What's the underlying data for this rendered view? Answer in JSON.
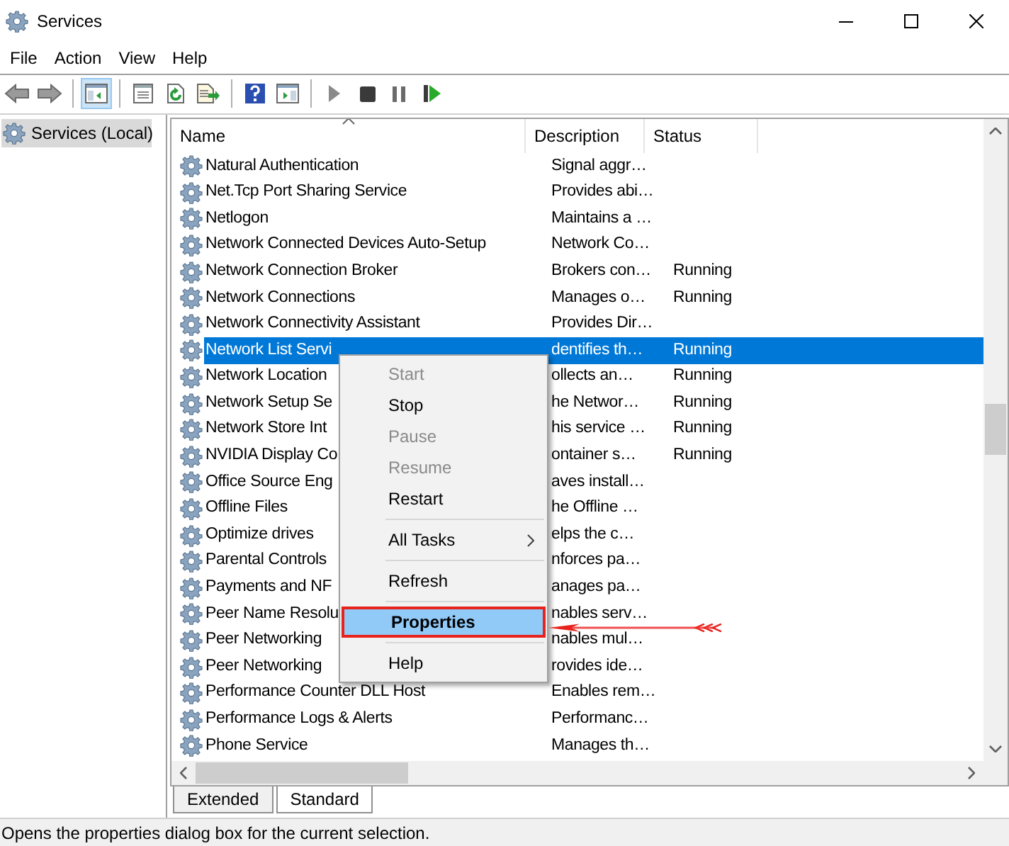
{
  "window": {
    "title": "Services"
  },
  "menu_bar": [
    "File",
    "Action",
    "View",
    "Help"
  ],
  "toolbar": [
    [
      {
        "kind": "back",
        "pressed": false
      },
      {
        "kind": "forward",
        "pressed": false
      }
    ],
    [
      {
        "kind": "tree",
        "pressed": true
      }
    ],
    [
      {
        "kind": "props",
        "pressed": false
      },
      {
        "kind": "refresh",
        "pressed": false
      },
      {
        "kind": "export",
        "pressed": false
      }
    ],
    [
      {
        "kind": "help",
        "pressed": false
      },
      {
        "kind": "pane",
        "pressed": false
      }
    ],
    [
      {
        "kind": "play",
        "pressed": false
      },
      {
        "kind": "stop",
        "pressed": false
      },
      {
        "kind": "pause",
        "pressed": false
      },
      {
        "kind": "restart",
        "pressed": false
      }
    ]
  ],
  "tree": {
    "items": [
      {
        "label": "Services (Local)",
        "selected": true
      }
    ]
  },
  "table": {
    "columns": [
      {
        "label": "Name",
        "sorted": true
      },
      {
        "label": "Description",
        "sorted": false
      },
      {
        "label": "Status",
        "sorted": false
      }
    ],
    "rows": [
      {
        "name": "Natural Authentication",
        "description": "Signal aggr…",
        "selected": false
      },
      {
        "name": "Net.Tcp Port Sharing Service",
        "description": "Provides abi…",
        "selected": false
      },
      {
        "name": "Netlogon",
        "description": "Maintains a …",
        "selected": false
      },
      {
        "name": "Network Connected Devices Auto-Setup",
        "description": "Network Co…",
        "selected": false
      },
      {
        "name": "Network Connection Broker",
        "description": "Brokers con…",
        "status": "Running",
        "selected": false
      },
      {
        "name": "Network Connections",
        "description": "Manages o…",
        "status": "Running",
        "selected": false
      },
      {
        "name": "Network Connectivity Assistant",
        "description": "Provides Dir…",
        "selected": false
      },
      {
        "name": "Network List Servi",
        "description": "dentifies th…",
        "status": "Running",
        "selected": true
      },
      {
        "name": "Network Location",
        "description": "ollects an…",
        "status": "Running",
        "selected": false
      },
      {
        "name": "Network Setup Se",
        "description": "he Networ…",
        "status": "Running",
        "selected": false
      },
      {
        "name": "Network Store Int",
        "description": "his service …",
        "status": "Running",
        "selected": false
      },
      {
        "name": "NVIDIA Display Co",
        "description": "ontainer s…",
        "status": "Running",
        "selected": false
      },
      {
        "name": "Office Source Eng",
        "description": "aves install…",
        "selected": false
      },
      {
        "name": "Offline Files",
        "description": "he Offline …",
        "selected": false
      },
      {
        "name": "Optimize drives",
        "description": "elps the c…",
        "selected": false
      },
      {
        "name": "Parental Controls",
        "description": "nforces pa…",
        "selected": false
      },
      {
        "name": "Payments and NF",
        "description": "anages pa…",
        "selected": false
      },
      {
        "name": "Peer Name Resolu",
        "description": "nables serv…",
        "selected": false
      },
      {
        "name": "Peer Networking",
        "description": "nables mul…",
        "selected": false
      },
      {
        "name": "Peer Networking",
        "description": "rovides ide…",
        "selected": false
      },
      {
        "name": "Performance Counter DLL Host",
        "description": "Enables rem…",
        "selected": false
      },
      {
        "name": "Performance Logs & Alerts",
        "description": "Performanc…",
        "selected": false
      },
      {
        "name": "Phone Service",
        "description": "Manages th…",
        "selected": false
      }
    ]
  },
  "context_menu": {
    "items": [
      {
        "kind": "item",
        "label": "Start",
        "disabled": true,
        "highlighted": false,
        "submenu": false
      },
      {
        "kind": "item",
        "label": "Stop",
        "disabled": false,
        "highlighted": false,
        "submenu": false
      },
      {
        "kind": "item",
        "label": "Pause",
        "disabled": true,
        "highlighted": false,
        "submenu": false
      },
      {
        "kind": "item",
        "label": "Resume",
        "disabled": true,
        "highlighted": false,
        "submenu": false
      },
      {
        "kind": "item",
        "label": "Restart",
        "disabled": false,
        "highlighted": false,
        "submenu": false
      },
      {
        "kind": "separator"
      },
      {
        "kind": "item",
        "label": "All Tasks",
        "disabled": false,
        "highlighted": false,
        "submenu": true
      },
      {
        "kind": "separator"
      },
      {
        "kind": "item",
        "label": "Refresh",
        "disabled": false,
        "highlighted": false,
        "submenu": false
      },
      {
        "kind": "separator"
      },
      {
        "kind": "item",
        "label": "Properties",
        "disabled": false,
        "highlighted": true,
        "submenu": false
      },
      {
        "kind": "separator"
      },
      {
        "kind": "item",
        "label": "Help",
        "disabled": false,
        "highlighted": false,
        "submenu": false
      }
    ]
  },
  "tabs": [
    {
      "label": "Extended",
      "selected": false
    },
    {
      "label": "Standard",
      "selected": true
    }
  ],
  "status_bar": "Opens the properties dialog box for the current selection."
}
